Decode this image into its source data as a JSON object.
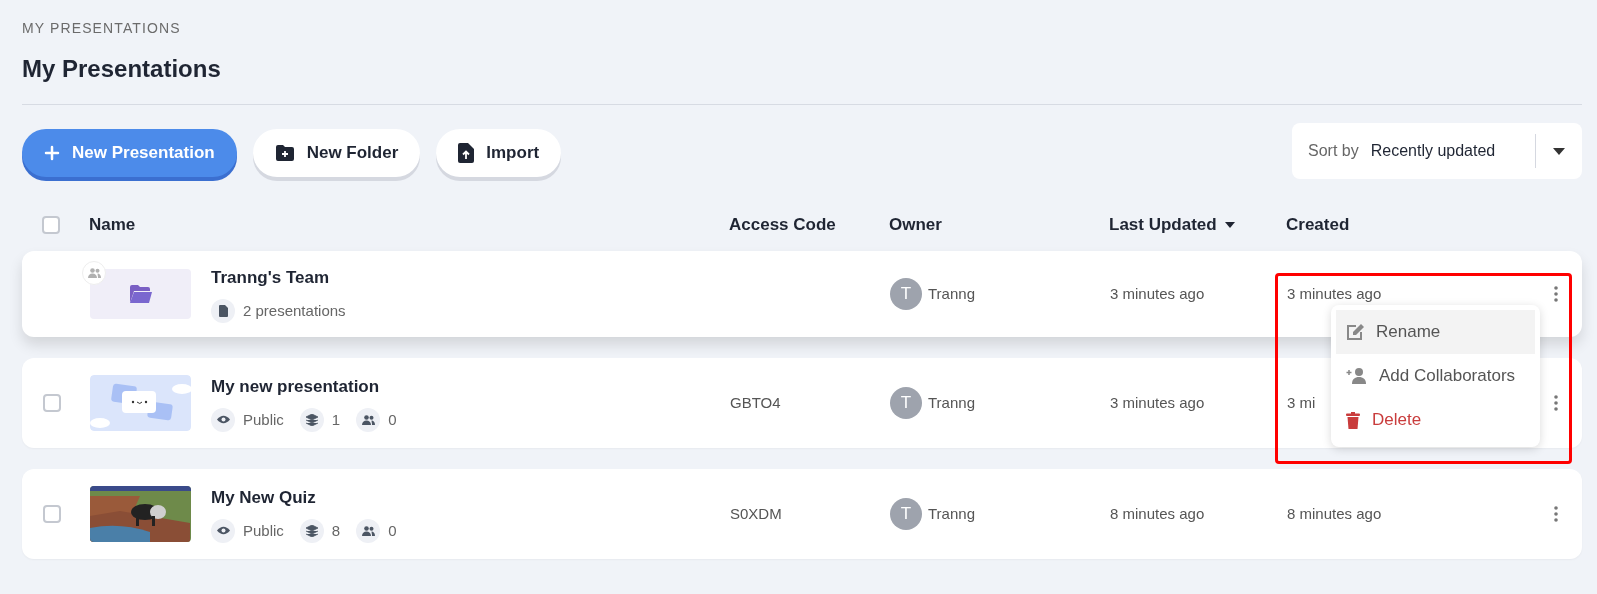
{
  "breadcrumb": "MY PRESENTATIONS",
  "title": "My Presentations",
  "actions": [
    {
      "kind": "primary",
      "label": "New Presentation"
    },
    {
      "kind": "folder",
      "label": "New Folder"
    },
    {
      "kind": "import",
      "label": "Import"
    }
  ],
  "sort": {
    "label": "Sort by",
    "value": "Recently updated"
  },
  "select_all": {
    "checked": false
  },
  "columns": [
    {
      "label": "Name",
      "sorted": false
    },
    {
      "label": "Access Code",
      "sorted": false
    },
    {
      "label": "Owner",
      "sorted": false
    },
    {
      "label": "Last Updated",
      "sorted": true
    },
    {
      "label": "Created",
      "sorted": false
    }
  ],
  "rows": [
    {
      "kind": "folder",
      "highlighted": true,
      "shared": true,
      "name": "Tranng's Team",
      "count": "2 presentations",
      "access_code": "",
      "owner_initial": "T",
      "owner": "Tranng",
      "last_updated": "3 minutes ago",
      "created": "3 minutes ago"
    },
    {
      "kind": "presentation",
      "highlighted": false,
      "checked": false,
      "thumbnail": {
        "kind": "illustration"
      },
      "name": "My new presentation",
      "visibility": "Public",
      "slides": "1",
      "collaborators": "0",
      "access_code": "GBTO4",
      "owner_initial": "T",
      "owner": "Tranng",
      "last_updated": "3 minutes ago",
      "created": "3 mi"
    },
    {
      "kind": "presentation",
      "highlighted": false,
      "checked": false,
      "name": "My New Quiz",
      "visibility": "Public",
      "slides": "8",
      "collaborators": "0",
      "access_code": "S0XDM",
      "owner_initial": "T",
      "owner": "Tranng",
      "last_updated": "8 minutes ago",
      "created": "8 minutes ago"
    }
  ],
  "menu": {
    "items": [
      {
        "kind": "edit",
        "label": "Rename",
        "highlighted": true
      },
      {
        "kind": "add-user",
        "label": "Add Collaborators",
        "highlighted": false
      },
      {
        "kind": "delete",
        "label": "Delete",
        "highlighted": false
      }
    ]
  }
}
